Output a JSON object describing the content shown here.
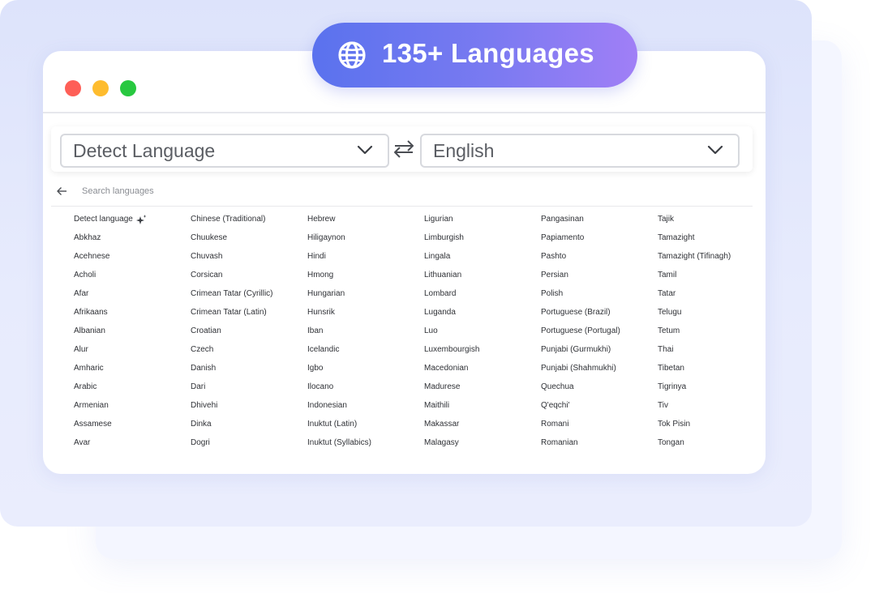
{
  "badge": {
    "label": "135+ Languages",
    "icon": "globe-icon"
  },
  "selector": {
    "source_language": "Detect Language",
    "target_language": "English",
    "swap_icon": "swap-arrows-icon"
  },
  "search": {
    "placeholder": "Search languages",
    "value": ""
  },
  "colors": {
    "badge_gradient_start": "#5a72ee",
    "badge_gradient_end": "#a07ff6",
    "traffic_red": "#fe5f57",
    "traffic_yellow": "#febc2e",
    "traffic_green": "#28c840",
    "background_panel": "#dde3fb"
  },
  "languages": [
    [
      "Detect language",
      "Abkhaz",
      "Acehnese",
      "Acholi",
      "Afar",
      "Afrikaans",
      "Albanian",
      "Alur",
      "Amharic",
      "Arabic",
      "Armenian",
      "Assamese",
      "Avar"
    ],
    [
      "Chinese (Traditional)",
      "Chuukese",
      "Chuvash",
      "Corsican",
      "Crimean Tatar (Cyrillic)",
      "Crimean Tatar (Latin)",
      "Croatian",
      "Czech",
      "Danish",
      "Dari",
      "Dhivehi",
      "Dinka",
      "Dogri"
    ],
    [
      "Hebrew",
      "Hiligaynon",
      "Hindi",
      "Hmong",
      "Hungarian",
      "Hunsrik",
      "Iban",
      "Icelandic",
      "Igbo",
      "Ilocano",
      "Indonesian",
      "Inuktut (Latin)",
      "Inuktut (Syllabics)"
    ],
    [
      "Ligurian",
      "Limburgish",
      "Lingala",
      "Lithuanian",
      "Lombard",
      "Luganda",
      "Luo",
      "Luxembourgish",
      "Macedonian",
      "Madurese",
      "Maithili",
      "Makassar",
      "Malagasy"
    ],
    [
      "Pangasinan",
      "Papiamento",
      "Pashto",
      "Persian",
      "Polish",
      "Portuguese (Brazil)",
      "Portuguese (Portugal)",
      "Punjabi (Gurmukhi)",
      "Punjabi (Shahmukhi)",
      "Quechua",
      "Q'eqchi'",
      "Romani",
      "Romanian"
    ],
    [
      "Tajik",
      "Tamazight",
      "Tamazight (Tifinagh)",
      "Tamil",
      "Tatar",
      "Telugu",
      "Tetum",
      "Thai",
      "Tibetan",
      "Tigrinya",
      "Tiv",
      "Tok Pisin",
      "Tongan"
    ]
  ]
}
